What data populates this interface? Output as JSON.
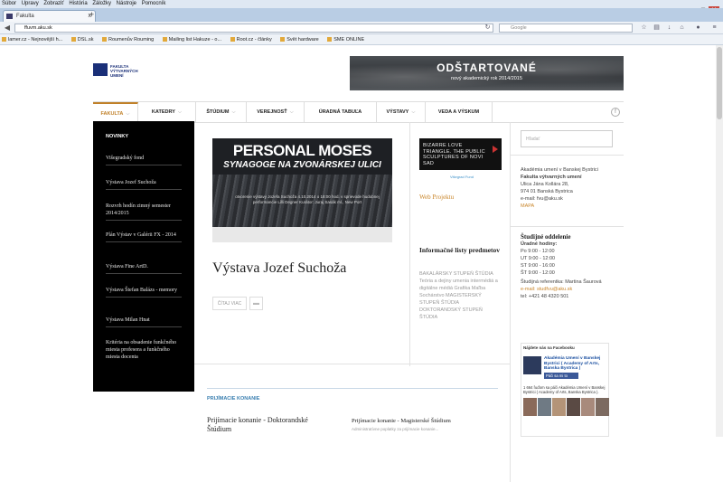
{
  "menubar": {
    "items": [
      "Súbor",
      "Úpravy",
      "Zobraziť",
      "História",
      "Záložky",
      "Nástroje",
      "Pomocník"
    ]
  },
  "tab": {
    "title": "Fakulta",
    "close": "x",
    "new": "+"
  },
  "window": {
    "min": "–",
    "max": "□",
    "close": "✕"
  },
  "navbar": {
    "url": "ffuvm.aku.sk",
    "search_placeholder": "Google"
  },
  "bookmarks": [
    "lamer.cz - Nejnovější h...",
    "DSL.sk",
    "Roumenův Rouming",
    "Mailing list Hakuze - o...",
    "Root.cz - články",
    "Svět hardware",
    "SME ONLINE"
  ],
  "logo": {
    "lines": [
      "FAKULTA",
      "VÝTVARNÝCH",
      "UMENÍ"
    ]
  },
  "banner": {
    "headline": "ODŠTARTOVANÉ",
    "sub": "nový akademický rok 2014/2015"
  },
  "mainnav": {
    "items": [
      {
        "label": "FAKULTA",
        "caret": "⌵"
      },
      {
        "label": "KATEDRY",
        "caret": "⌵"
      },
      {
        "label": "ŠTÚDIUM",
        "caret": "⌵"
      },
      {
        "label": "VEREJNOSŤ",
        "caret": "⌵"
      },
      {
        "label": "ÚRADNÁ TABUĽA",
        "caret": ""
      },
      {
        "label": "VÝSTAVY",
        "caret": "⌵"
      },
      {
        "label": "VEDA A VÝSKUM",
        "caret": ""
      }
    ],
    "fb": "f"
  },
  "sidebar": {
    "heading": "NOVINKY",
    "items": [
      "Višegradský fond",
      "Výstava Jozef Suchoža",
      "Rozvrh hodín zimný semester 2014/2015",
      "Plán Výstav v Galérii FX - 2014",
      "Výstava Fine ArtD.",
      "Výstava Štefan Balázs - memory",
      "Výstava Milan Hnat",
      "Kritéria na obsadenie funkčného miesta profesora a funkčného miesta docenta"
    ]
  },
  "feature": {
    "h1": "PERSONAL MOSES",
    "h2": "SYNAGOGE NA ZVONÁRSKEJ ULICI",
    "caption": "otvorenie výstavy Jozefa Suchoža 4.10.2014 o 18:00 hod. v sprievode hudobnej performancie Lilli Degner Kurátor: Juraj Sasák ml., New Port"
  },
  "article": {
    "title": "Výstava Jozef Suchoža",
    "readmore": "ČÍTAJ VIAC",
    "comment_icon": "▬"
  },
  "promo": {
    "text": "BIZARRE LOVE TRIANGLE. THE PUBLIC SCULPTURES OF NOVI SAD",
    "link": "Višegrad Fund"
  },
  "web_projekt": "Web Projektu",
  "info": {
    "title": "Informačné listy predmetov",
    "body": "BAKALÁRSKY STUPEŇ ŠTÚDIA Teória a dejiny umenia intermédiá a digitálne médiá Grafika Maľba Sochárstvo MAGISTERSKÝ STUPEŇ ŠTÚDIA DOKTORANDSKÝ STUPEŇ ŠTÚDIA"
  },
  "search_col3": "Hľadať",
  "address": {
    "line1": "Akadémia umení v Banskej Bystrici",
    "line2": "Fakulta výtvarných umení",
    "line3": "Ulica Jána Kollára 28,",
    "line4": "974 01 Banská Bystrica",
    "email": "e-mail: fvu@aku.sk",
    "map": "MAPA"
  },
  "studijne": {
    "title": "Študijné oddelenie",
    "hours_label": "Úradné hodiny:",
    "hours": [
      "Po 9:00 - 12:00",
      "UT 9:00 - 12:00",
      "ST 9:00 - 16:00",
      "ŠT 9:00 - 12:00"
    ],
    "referent": "Študijná referentka: Martina Šaurová",
    "email": "e-mail: studfvu@aku.sk",
    "tel": "tel: +421 48 4320 501"
  },
  "facebook": {
    "heading": "Nájdete nás na Facebooku",
    "page_name": "Akadémia Umení v Banskej Bystrici ( Academy of Arts, Banska Bystrica )",
    "like": "Páči sa mi to",
    "count": "1 664 ľuďom sa páči Akadémia Umení v Banskej Bystrici ( Academy of Arts, Banska Bystrica )."
  },
  "admissions": {
    "heading": "PRIJÍMACIE KONANIE",
    "item1": "Prijímacie konanie - Doktorandské Štúdium",
    "item2": "Prijímacie konanie - Magisterské Štúdium",
    "item2_sub": "Administratívne poplatky za prijímacie konanie..."
  },
  "colors": {
    "accent": "#c08028",
    "link": "#3a7fb0",
    "brand": "#1a2f78"
  }
}
